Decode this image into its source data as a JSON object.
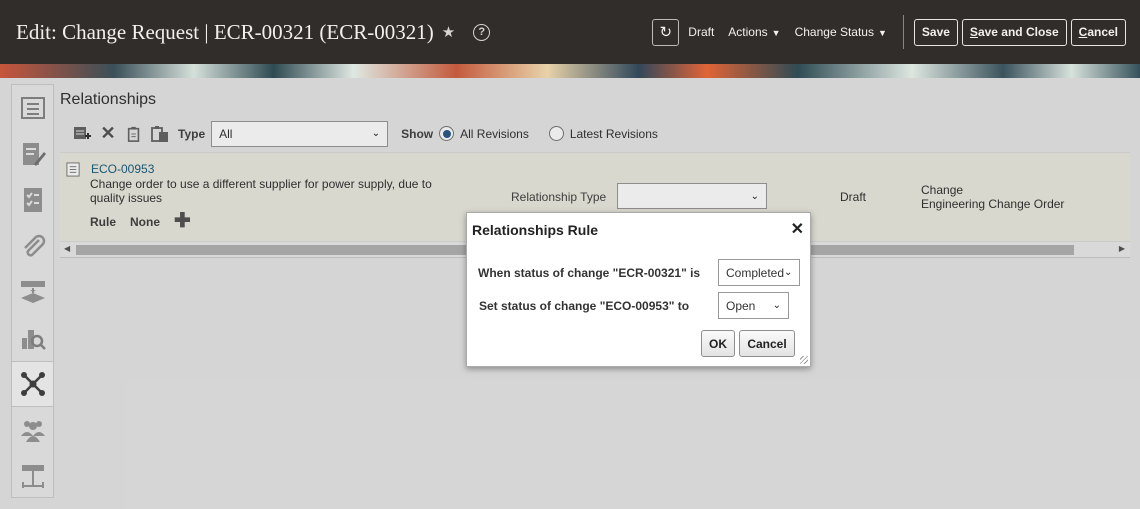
{
  "header": {
    "title": "Edit: Change Request | ECR-00321 (ECR-00321)",
    "status": "Draft",
    "actions_label": "Actions",
    "change_status_label": "Change Status",
    "save": "Save",
    "save_and_close_first": "S",
    "save_and_close_rest": "ave and Close",
    "cancel_first": "C",
    "cancel_rest": "ancel"
  },
  "panel": {
    "title": "Relationships",
    "type_label": "Type",
    "type_value": "All",
    "show_label": "Show",
    "show_options": [
      "All Revisions",
      "Latest Revisions"
    ],
    "show_selected": "All Revisions"
  },
  "row": {
    "link": "ECO-00953",
    "description": "Change order to use a different supplier for power supply, due to quality issues",
    "rule_label": "Rule",
    "rule_value": "None",
    "relationship_type_label": "Relationship Type",
    "relationship_type_value": "",
    "status": "Draft",
    "change_line1": "Change",
    "change_line2": "Engineering Change Order"
  },
  "dialog": {
    "title": "Relationships Rule",
    "line1": "When status of change \"ECR-00321\" is",
    "line1_value": "Completed",
    "line2": "Set status of change \"ECO-00953\" to",
    "line2_value": "Open",
    "ok": "OK",
    "cancel": "Cancel"
  },
  "icons": {
    "rail": [
      "overview-icon",
      "edit-document-icon",
      "checklist-icon",
      "attachment-icon",
      "workflow-icon",
      "analytics-icon",
      "relationships-icon",
      "people-icon",
      "hierarchy-icon"
    ],
    "active_rail": "relationships-icon"
  },
  "colors": {
    "header_bg": "#312d2a",
    "link": "#1b5f7e",
    "row_bg": "#ecebe0"
  }
}
